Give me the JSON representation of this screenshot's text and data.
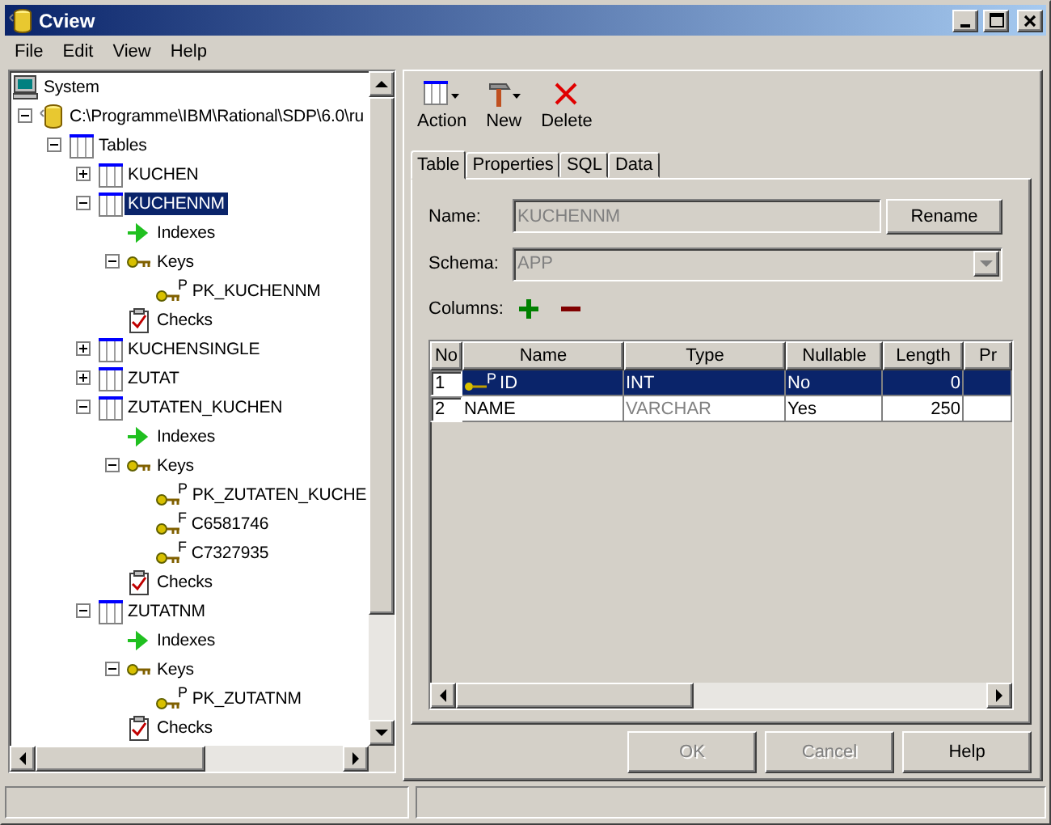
{
  "window": {
    "title": "Cview"
  },
  "menu": [
    "File",
    "Edit",
    "View",
    "Help"
  ],
  "tree": {
    "root": {
      "kind": "system",
      "label": "System"
    },
    "nodes": [
      {
        "kind": "database",
        "label": "C:\\Programme\\IBM\\Rational\\SDP\\6.0\\ru",
        "expanded": true,
        "selected": false,
        "children": [
          {
            "kind": "folder",
            "label": "Tables",
            "expanded": true,
            "selected": false,
            "children": [
              {
                "kind": "table",
                "label": "KUCHEN",
                "expanded": false,
                "selected": false
              },
              {
                "kind": "table",
                "label": "KUCHENNM",
                "expanded": true,
                "selected": true,
                "children": [
                  {
                    "kind": "indexes",
                    "label": "Indexes",
                    "selected": false
                  },
                  {
                    "kind": "keys",
                    "label": "Keys",
                    "expanded": true,
                    "selected": false,
                    "children": [
                      {
                        "kind": "key",
                        "letter": "P",
                        "label": "PK_KUCHENNM",
                        "selected": false
                      }
                    ]
                  },
                  {
                    "kind": "checks",
                    "label": "Checks",
                    "selected": false
                  }
                ]
              },
              {
                "kind": "table",
                "label": "KUCHENSINGLE",
                "expanded": false,
                "selected": false
              },
              {
                "kind": "table",
                "label": "ZUTAT",
                "expanded": false,
                "selected": false
              },
              {
                "kind": "table",
                "label": "ZUTATEN_KUCHEN",
                "expanded": true,
                "selected": false,
                "children": [
                  {
                    "kind": "indexes",
                    "label": "Indexes",
                    "selected": false
                  },
                  {
                    "kind": "keys",
                    "label": "Keys",
                    "expanded": true,
                    "selected": false,
                    "children": [
                      {
                        "kind": "key",
                        "letter": "P",
                        "label": "PK_ZUTATEN_KUCHE",
                        "selected": false
                      },
                      {
                        "kind": "key",
                        "letter": "F",
                        "label": "C6581746",
                        "selected": false
                      },
                      {
                        "kind": "key",
                        "letter": "F",
                        "label": "C7327935",
                        "selected": false
                      }
                    ]
                  },
                  {
                    "kind": "checks",
                    "label": "Checks",
                    "selected": false
                  }
                ]
              },
              {
                "kind": "table",
                "label": "ZUTATNM",
                "expanded": true,
                "selected": false,
                "children": [
                  {
                    "kind": "indexes",
                    "label": "Indexes",
                    "selected": false
                  },
                  {
                    "kind": "keys",
                    "label": "Keys",
                    "expanded": true,
                    "selected": false,
                    "children": [
                      {
                        "kind": "key",
                        "letter": "P",
                        "label": "PK_ZUTATNM",
                        "selected": false
                      }
                    ]
                  },
                  {
                    "kind": "checks",
                    "label": "Checks",
                    "selected": false
                  }
                ]
              }
            ]
          }
        ]
      }
    ]
  },
  "toolbar": [
    {
      "kind": "action",
      "label": "Action"
    },
    {
      "kind": "new",
      "label": "New"
    },
    {
      "kind": "delete",
      "label": "Delete"
    }
  ],
  "tabs": [
    {
      "label": "Table",
      "selected": true
    },
    {
      "label": "Properties",
      "selected": false
    },
    {
      "label": "SQL",
      "selected": false
    },
    {
      "label": "Data",
      "selected": false
    }
  ],
  "form": {
    "name_label": "Name:",
    "name_value": "KUCHENNM",
    "rename": "Rename",
    "schema_label": "Schema:",
    "schema_value": "APP",
    "columns_label": "Columns:"
  },
  "grid": {
    "columns": [
      "No",
      "Name",
      "Type",
      "Nullable",
      "Length",
      "Pr"
    ],
    "rows": [
      {
        "no": "1",
        "key": "P",
        "name": "ID",
        "type": "INT",
        "nullable": "No",
        "length": "0",
        "selected": true
      },
      {
        "no": "2",
        "name": "NAME",
        "type": "VARCHAR",
        "nullable": "Yes",
        "length": "250",
        "selected": false
      }
    ]
  },
  "buttons": [
    {
      "label": "OK",
      "disabled": true
    },
    {
      "label": "Cancel",
      "disabled": true
    },
    {
      "label": "Help",
      "disabled": false
    }
  ]
}
